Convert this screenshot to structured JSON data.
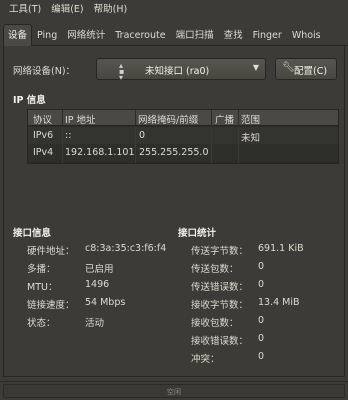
{
  "menubar": {
    "items": [
      "工具(T)",
      "编辑(E)",
      "帮助(H)"
    ]
  },
  "tabs": [
    "设备",
    "Ping",
    "网络统计",
    "Traceroute",
    "端口扫描",
    "查找",
    "Finger",
    "Whois"
  ],
  "device": {
    "label": "网络设备(N)：",
    "selected": "未知接口 (ra0)",
    "config_button": "配置(C)"
  },
  "ip_info": {
    "title": "IP 信息",
    "columns": [
      "协议",
      "IP 地址",
      "网络掩码/前缀",
      "广播",
      "范围"
    ],
    "rows": [
      [
        "IPv6",
        "::",
        "0",
        "",
        "未知"
      ],
      [
        "IPv4",
        "192.168.1.101",
        "255.255.255.0",
        "",
        ""
      ]
    ]
  },
  "iface_info": {
    "title": "接口信息",
    "items": [
      {
        "label": "硬件地址：",
        "value": "c8:3a:35:c3:f6:f4"
      },
      {
        "label": "多播：",
        "value": "已启用"
      },
      {
        "label": "MTU：",
        "value": "1496"
      },
      {
        "label": "链接速度：",
        "value": "54 Mbps"
      },
      {
        "label": "状态：",
        "value": "活动"
      }
    ]
  },
  "iface_stats": {
    "title": "接口统计",
    "items": [
      {
        "label": "传送字节数：",
        "value": "691.1 KiB"
      },
      {
        "label": "传送包数：",
        "value": "0"
      },
      {
        "label": "传送错误数：",
        "value": "0"
      },
      {
        "label": "接收字节数：",
        "value": "13.4 MiB"
      },
      {
        "label": "接收包数：",
        "value": "0"
      },
      {
        "label": "接收错误数：",
        "value": "0"
      },
      {
        "label": "冲突：",
        "value": "0"
      }
    ]
  },
  "status": {
    "text": "空闲"
  }
}
